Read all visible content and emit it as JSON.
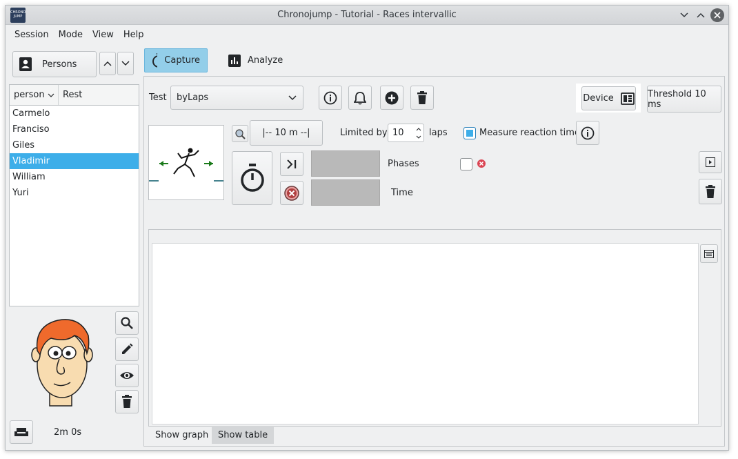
{
  "window": {
    "title": "Chronojump - Tutorial - Races intervallic",
    "logo_text": "CHRONO JUMP"
  },
  "menu": [
    "Session",
    "Mode",
    "View",
    "Help"
  ],
  "persons": {
    "button_label": "Persons",
    "columns": [
      "person",
      "Rest"
    ],
    "rows": [
      "Carmelo",
      "Franciso",
      "Giles",
      "Vladimir",
      "William",
      "Yuri"
    ],
    "selected": "Vladimir"
  },
  "rest": {
    "label": "2m 0s"
  },
  "tabs": {
    "capture": "Capture",
    "analyze": "Analyze"
  },
  "test": {
    "label": "Test",
    "value": "byLaps",
    "device_label": "Device",
    "threshold_label": "Threshold 10 ms",
    "distance_label": "|-- 10 m --|",
    "limited_by_label": "Limited by",
    "limited_by_value": "10",
    "laps_label": "laps",
    "measure_reaction_label": "Measure reaction time",
    "measure_reaction_checked": true,
    "phases_label": "Phases",
    "time_label": "Time"
  },
  "bottom_tabs": {
    "graph": "Show graph",
    "table": "Show table"
  },
  "colors": {
    "accent": "#3daee9",
    "tab_active": "#93cee9"
  }
}
